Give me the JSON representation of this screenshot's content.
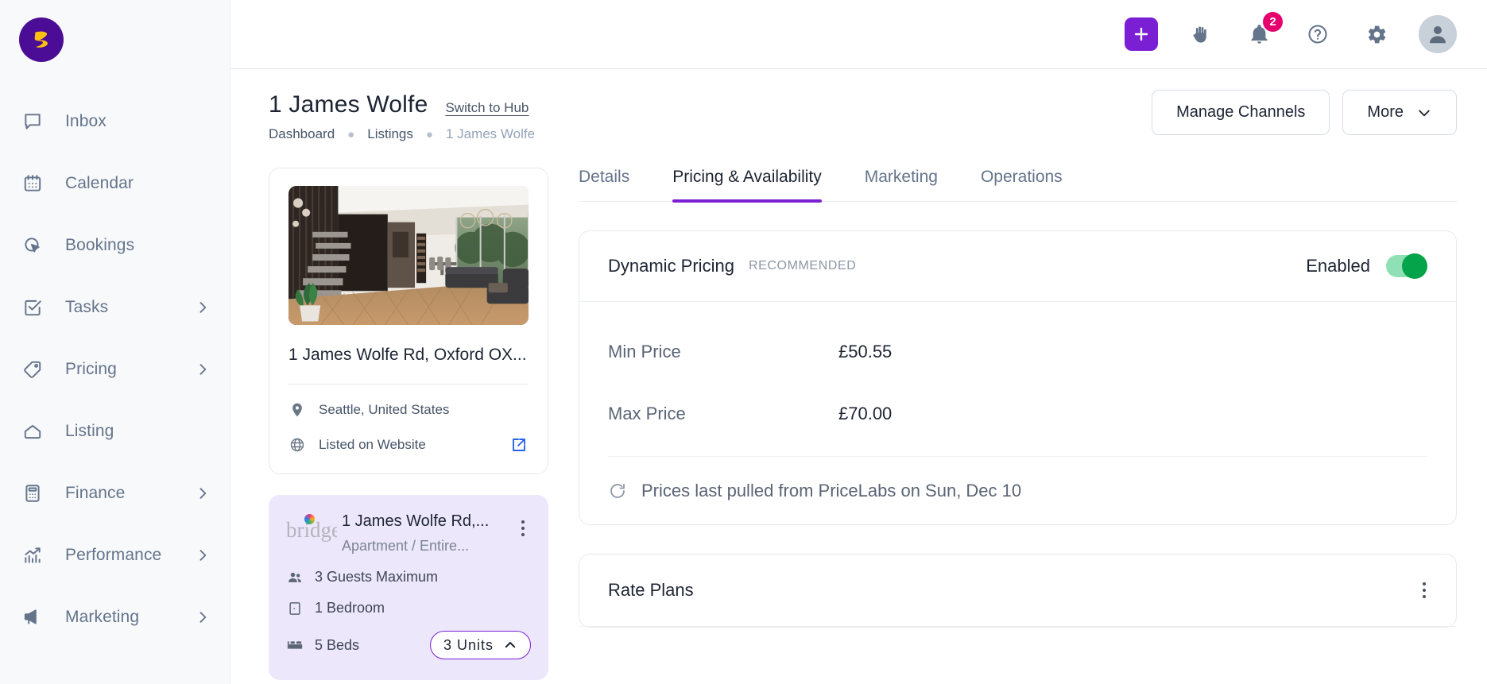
{
  "brand": {
    "logo_letter": "Z"
  },
  "sidebar": {
    "items": [
      {
        "label": "Inbox",
        "icon": "inbox-chat-icon",
        "chevron": false
      },
      {
        "label": "Calendar",
        "icon": "calendar-icon",
        "chevron": false
      },
      {
        "label": "Bookings",
        "icon": "bookings-icon",
        "chevron": false
      },
      {
        "label": "Tasks",
        "icon": "tasks-check-icon",
        "chevron": true
      },
      {
        "label": "Pricing",
        "icon": "price-tag-icon",
        "chevron": true
      },
      {
        "label": "Listing",
        "icon": "home-icon",
        "chevron": false
      },
      {
        "label": "Finance",
        "icon": "calculator-icon",
        "chevron": true
      },
      {
        "label": "Performance",
        "icon": "chart-up-icon",
        "chevron": true
      },
      {
        "label": "Marketing",
        "icon": "megaphone-icon",
        "chevron": true
      }
    ]
  },
  "topbar": {
    "icons": [
      {
        "name": "add-plus-icon",
        "badge": null
      },
      {
        "name": "hand-raise-icon",
        "badge": null
      },
      {
        "name": "notifications-bell-icon",
        "badge": "2"
      },
      {
        "name": "help-question-icon",
        "badge": null
      },
      {
        "name": "settings-gear-icon",
        "badge": null
      }
    ],
    "notification_count": "2",
    "avatar": "user-avatar-icon",
    "accent_purple": "#7b1fd4",
    "badge_color": "#e5006d"
  },
  "header": {
    "title": "1 James Wolfe",
    "switch_link": "Switch to Hub",
    "breadcrumb": [
      "Dashboard",
      "Listings",
      "1 James Wolfe"
    ],
    "manage_channels": "Manage Channels",
    "more": "More"
  },
  "property": {
    "address": "1 James Wolfe Rd, Oxford OX...",
    "location": "Seattle, United States",
    "listed": "Listed on Website",
    "photo_alt": "modern-loft-interior-photo"
  },
  "unit": {
    "channel_logo": "bridge",
    "title": "1 James Wolfe Rd,...",
    "subtitle": "Apartment / Entire...",
    "guests": "3 Guests Maximum",
    "bedrooms": "1 Bedroom",
    "beds": "5 Beds",
    "units_pill": "3 Units",
    "card_bg": "#ece7fb",
    "pill_border": "#7b1fd4"
  },
  "tabs": [
    {
      "label": "Details",
      "active": false
    },
    {
      "label": "Pricing & Availability",
      "active": true
    },
    {
      "label": "Marketing",
      "active": false
    },
    {
      "label": "Operations",
      "active": false
    }
  ],
  "dynamic_pricing": {
    "title": "Dynamic Pricing",
    "tag": "RECOMMENDED",
    "toggle_label": "Enabled",
    "toggle_on": true,
    "toggle_color": "#05a34a",
    "rows": [
      {
        "label": "Min Price",
        "value": "£50.55"
      },
      {
        "label": "Max Price",
        "value": "£70.00"
      }
    ],
    "footer": "Prices last pulled from PriceLabs on Sun, Dec 10"
  },
  "rate_plans": {
    "title": "Rate Plans"
  }
}
